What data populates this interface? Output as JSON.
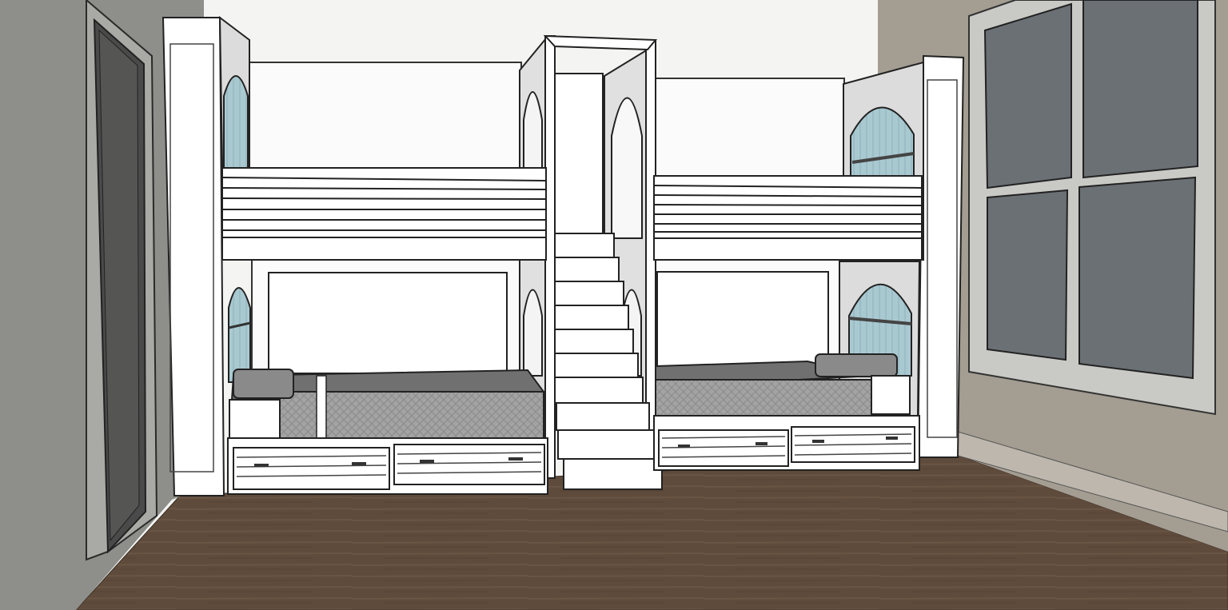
{
  "scene": {
    "subject": "bunk-room-render",
    "colors": {
      "wall_left": "#8c8c88",
      "wall_back": "#f4f4f2",
      "wall_right": "#a39d92",
      "floor": "#5e4a3a",
      "millwork": "#ffffff",
      "outline": "#1a1a1a",
      "mattress": "#9a9a9a",
      "mattress_top": "#6e6e6e",
      "niche_blue": "#a9c9d1",
      "window_glass": "#6b7075",
      "window_frame": "#c9c9c6",
      "door": "#4a4a4a"
    }
  }
}
